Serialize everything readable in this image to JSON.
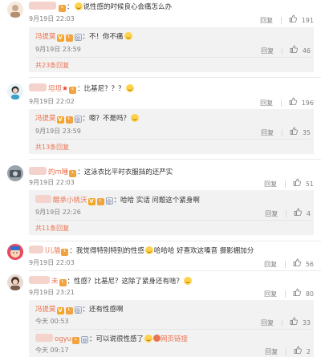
{
  "labels": {
    "reply": "回复",
    "colon": "："
  },
  "colors": {
    "accent": "#eb7350",
    "meta": "#808080",
    "reply_bg": "#f2f2f2"
  },
  "comments": [
    {
      "username": "",
      "text": "说性感的时候良心会痛怎么办",
      "date": "9月19日 22:03",
      "likes": "191",
      "replies": [
        {
          "username": "冯提莫",
          "text": "不！你不痛",
          "date": "9月19日 23:59",
          "likes": "46"
        }
      ],
      "expand": "共23条回复"
    },
    {
      "username": "坦坦",
      "text": "比基尼？？？",
      "date": "9月19日 22:02",
      "likes": "196",
      "replies": [
        {
          "username": "冯提莫",
          "text": "嗯？不是吗？",
          "date": "9月19日 23:59",
          "likes": "35"
        }
      ],
      "expand": "共13条回复"
    },
    {
      "username": "的m睡",
      "text": "这泳衣比平时衣服挡的还严实",
      "date": "9月19日 22:03",
      "likes": "51",
      "replies": [
        {
          "username": "醒承小桃沃",
          "text": "哈哈 实话 问题这个紧身啊",
          "date": "9月19日 22:26",
          "likes": "4"
        }
      ],
      "expand": "共11条回复"
    },
    {
      "username": "l儿猫",
      "text_before": "我觉得特别特别的性感",
      "text_after": "哈哈哈 好喜欢这嗓音 摄影棚加分",
      "date": "9月19日 22:03",
      "likes": "56"
    },
    {
      "username": "未",
      "text": "性感？比基尼？这除了紧身还有啥？",
      "date": "9月19日 23:21",
      "likes": "80",
      "replies": [
        {
          "username": "冯提莫",
          "text": "还有性感啊",
          "date": "今天 00:53",
          "likes": "33"
        },
        {
          "username": "ogyu",
          "text": "可以说很性感了",
          "link": "网页链接",
          "date": "今天 09:17",
          "likes": "2"
        }
      ]
    }
  ]
}
